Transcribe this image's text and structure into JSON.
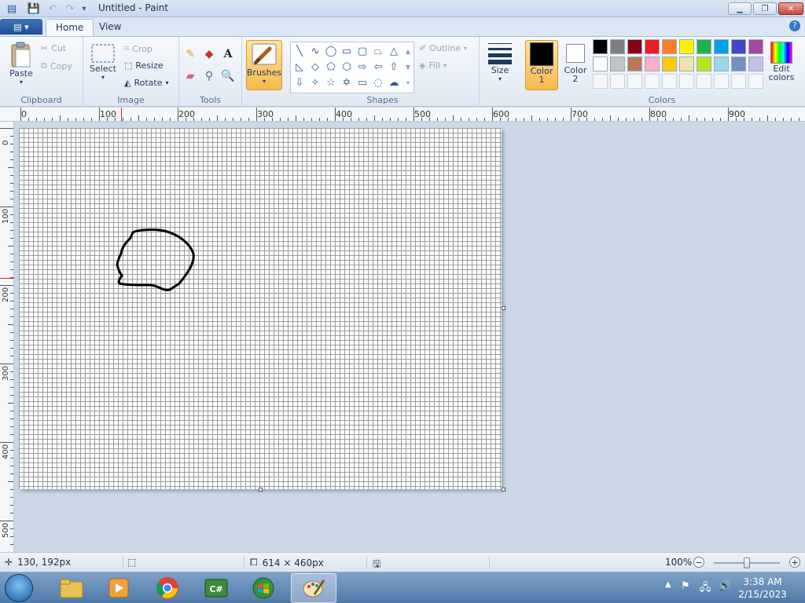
{
  "window": {
    "title": "Untitled - Paint"
  },
  "tabs": {
    "app_menu": "▤ ▾",
    "home": "Home",
    "view": "View"
  },
  "clipboard": {
    "paste": "Paste",
    "cut": "Cut",
    "copy": "Copy",
    "group": "Clipboard"
  },
  "image": {
    "select": "Select",
    "crop": "Crop",
    "resize": "Resize",
    "rotate": "Rotate",
    "group": "Image"
  },
  "tools": {
    "group": "Tools"
  },
  "brushes": {
    "label": "Brushes"
  },
  "shapes": {
    "outline": "Outline",
    "fill": "Fill",
    "group": "Shapes"
  },
  "size": {
    "label": "Size"
  },
  "colors": {
    "color1_line1": "Color",
    "color1_line2": "1",
    "color2_line1": "Color",
    "color2_line2": "2",
    "edit_line1": "Edit",
    "edit_line2": "colors",
    "group": "Colors",
    "color1_value": "#000000",
    "color2_value": "#ffffff",
    "palette_row1": [
      "#000000",
      "#7f7f7f",
      "#880015",
      "#ed1c24",
      "#ff7f27",
      "#fff200",
      "#22b14c",
      "#00a2e8",
      "#3f48cc",
      "#a349a4"
    ],
    "palette_row2": [
      "#ffffff",
      "#c3c3c3",
      "#b97a57",
      "#ffaec9",
      "#ffc90e",
      "#efe4b0",
      "#b5e61d",
      "#99d9ea",
      "#7092be",
      "#c8bfe7"
    ],
    "palette_row3": [
      "#f5f7fa",
      "#f5f7fa",
      "#f5f7fa",
      "#f5f7fa",
      "#f5f7fa",
      "#f5f7fa",
      "#f5f7fa",
      "#f5f7fa",
      "#f5f7fa",
      "#f5f7fa"
    ]
  },
  "ruler": {
    "h": [
      "0",
      "100",
      "200",
      "300",
      "400",
      "500",
      "600",
      "700",
      "800",
      "900"
    ],
    "v": [
      "0",
      "100",
      "200",
      "300",
      "400",
      "500"
    ]
  },
  "status": {
    "cursor_pos": "130, 192px",
    "canvas_size": "614 × 460px",
    "zoom": "100%",
    "zoom_level": 1.0
  },
  "taskbar": {
    "time": "3:38 AM",
    "date": "2/15/2023"
  }
}
